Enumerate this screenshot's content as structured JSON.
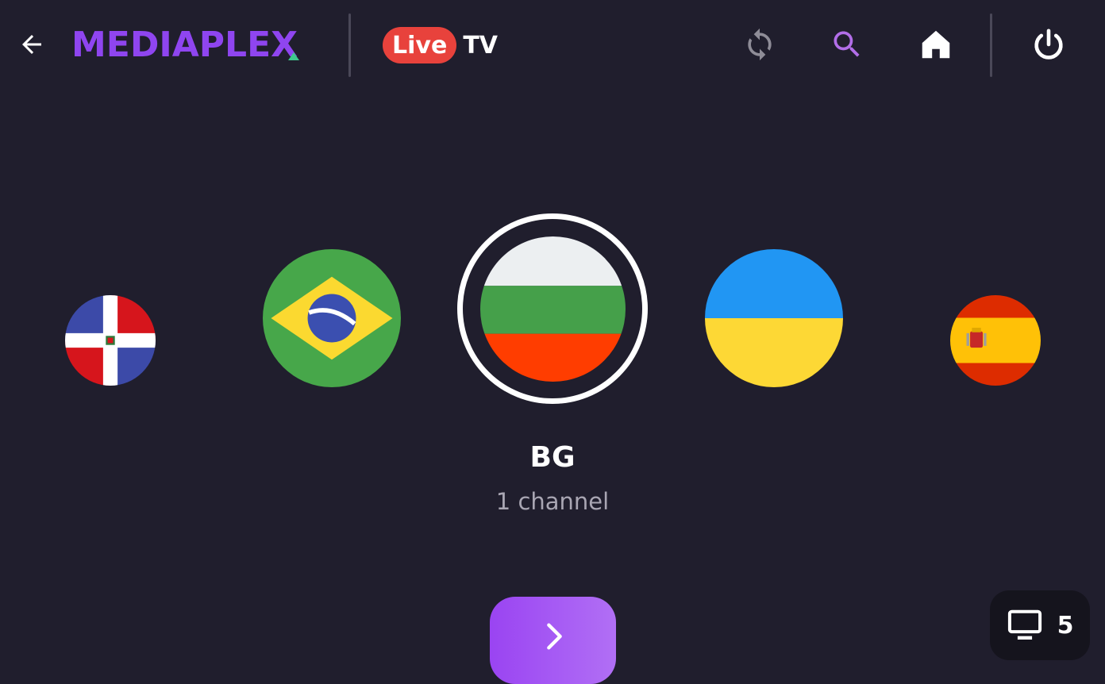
{
  "header": {
    "logo_text": "MEDIAPLEX",
    "live_label": "Live",
    "tv_label": "TV",
    "icons": [
      "back-arrow-icon",
      "refresh-icon",
      "search-icon",
      "home-icon",
      "power-icon"
    ]
  },
  "countries": [
    {
      "code": "DO",
      "flag": "dominican-republic-flag-icon"
    },
    {
      "code": "BR",
      "flag": "brazil-flag-icon"
    },
    {
      "code": "BG",
      "flag": "bulgaria-flag-icon",
      "selected": true
    },
    {
      "code": "UA",
      "flag": "ukraine-flag-icon"
    },
    {
      "code": "ES",
      "flag": "spain-flag-icon"
    }
  ],
  "selected": {
    "code": "BG",
    "channels_label": "1 channel"
  },
  "channel_badge": {
    "icon": "tv-monitor-icon",
    "count": "5"
  },
  "colors": {
    "background": "#201e2d",
    "brand_purple": "#8f45f0",
    "live_red": "#e8423c",
    "accent_green": "#3ec98d",
    "search_purple": "#b26ee8"
  }
}
